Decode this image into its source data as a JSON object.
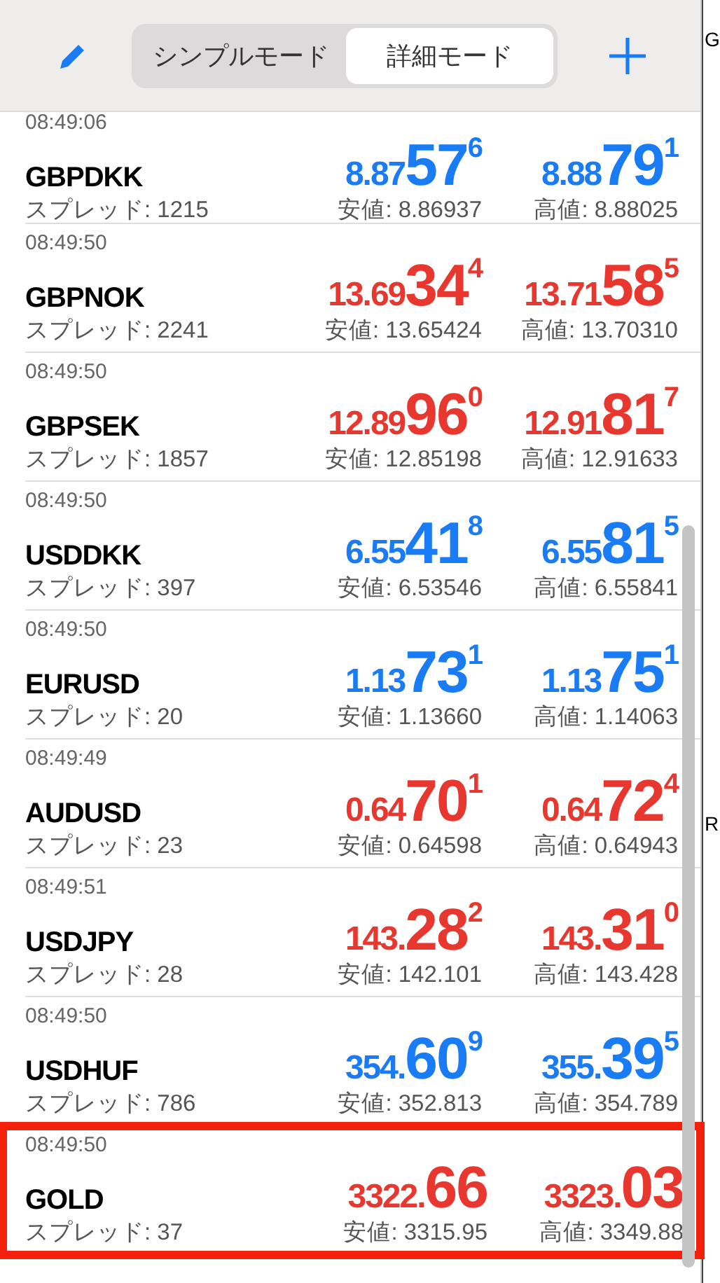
{
  "header": {
    "modes": [
      {
        "label": "シンプルモード",
        "selected": false
      },
      {
        "label": "詳細モード",
        "selected": true
      }
    ]
  },
  "quotes": [
    {
      "time": "08:49:06",
      "symbol": "GBPDKK",
      "color": "#1a7cf5",
      "bid": {
        "prefix": "8.87",
        "big": "57",
        "sup": "6"
      },
      "ask": {
        "prefix": "8.88",
        "big": "79",
        "sup": "1"
      },
      "spread": "スプレッド: 1215",
      "low": "安値: 8.86937",
      "high": "高値: 8.88025",
      "highlighted": false
    },
    {
      "time": "08:49:50",
      "symbol": "GBPNOK",
      "color": "#e8372e",
      "bid": {
        "prefix": "13.69",
        "big": "34",
        "sup": "4"
      },
      "ask": {
        "prefix": "13.71",
        "big": "58",
        "sup": "5"
      },
      "spread": "スプレッド: 2241",
      "low": "安値: 13.65424",
      "high": "高値: 13.70310",
      "highlighted": false
    },
    {
      "time": "08:49:50",
      "symbol": "GBPSEK",
      "color": "#e8372e",
      "bid": {
        "prefix": "12.89",
        "big": "96",
        "sup": "0"
      },
      "ask": {
        "prefix": "12.91",
        "big": "81",
        "sup": "7"
      },
      "spread": "スプレッド: 1857",
      "low": "安値: 12.85198",
      "high": "高値: 12.91633",
      "highlighted": false
    },
    {
      "time": "08:49:50",
      "symbol": "USDDKK",
      "color": "#1a7cf5",
      "bid": {
        "prefix": "6.55",
        "big": "41",
        "sup": "8"
      },
      "ask": {
        "prefix": "6.55",
        "big": "81",
        "sup": "5"
      },
      "spread": "スプレッド: 397",
      "low": "安値: 6.53546",
      "high": "高値: 6.55841",
      "highlighted": false
    },
    {
      "time": "08:49:50",
      "symbol": "EURUSD",
      "color": "#1a7cf5",
      "bid": {
        "prefix": "1.13",
        "big": "73",
        "sup": "1"
      },
      "ask": {
        "prefix": "1.13",
        "big": "75",
        "sup": "1"
      },
      "spread": "スプレッド: 20",
      "low": "安値: 1.13660",
      "high": "高値: 1.14063",
      "highlighted": false
    },
    {
      "time": "08:49:49",
      "symbol": "AUDUSD",
      "color": "#e8372e",
      "bid": {
        "prefix": "0.64",
        "big": "70",
        "sup": "1"
      },
      "ask": {
        "prefix": "0.64",
        "big": "72",
        "sup": "4"
      },
      "spread": "スプレッド: 23",
      "low": "安値: 0.64598",
      "high": "高値: 0.64943",
      "highlighted": false
    },
    {
      "time": "08:49:51",
      "symbol": "USDJPY",
      "color": "#e8372e",
      "bid": {
        "prefix": "143.",
        "big": "28",
        "sup": "2"
      },
      "ask": {
        "prefix": "143.",
        "big": "31",
        "sup": "0"
      },
      "spread": "スプレッド: 28",
      "low": "安値: 142.101",
      "high": "高値: 143.428",
      "highlighted": false
    },
    {
      "time": "08:49:50",
      "symbol": "USDHUF",
      "color": "#1a7cf5",
      "bid": {
        "prefix": "354.",
        "big": "60",
        "sup": "9"
      },
      "ask": {
        "prefix": "355.",
        "big": "39",
        "sup": "5"
      },
      "spread": "スプレッド: 786",
      "low": "安値: 352.813",
      "high": "高値: 354.789",
      "highlighted": false
    },
    {
      "time": "08:49:50",
      "symbol": "GOLD",
      "color": "#e8372e",
      "bid": {
        "prefix": "3322.",
        "big": "66"
      },
      "ask": {
        "prefix": "3323.",
        "big": "03"
      },
      "spread": "スプレッド: 37",
      "low": "安値: 3315.95",
      "high": "高値: 3349.88",
      "highlighted": true
    }
  ],
  "side_panel": {
    "labels": [
      "G",
      "R"
    ]
  }
}
